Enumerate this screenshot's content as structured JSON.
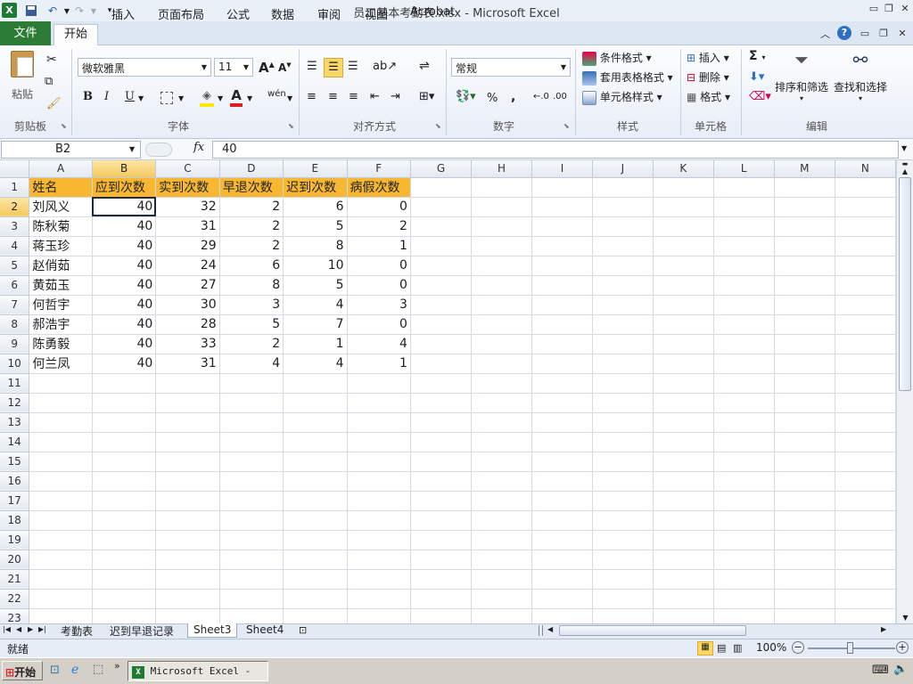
{
  "window": {
    "title": "员工基本考勤表.xlsx - Microsoft Excel",
    "app_icon": "excel-icon"
  },
  "ribbon_tabs": [
    "文件",
    "开始",
    "插入",
    "页面布局",
    "公式",
    "数据",
    "审阅",
    "视图",
    "Acrobat"
  ],
  "ribbon": {
    "clipboard": {
      "paste": "粘贴",
      "label": "剪贴板"
    },
    "font": {
      "name": "微软雅黑",
      "size": "11",
      "label": "字体",
      "bold": "B",
      "italic": "I",
      "underline": "U",
      "grow": "A",
      "shrink": "A",
      "color_a": "A",
      "wen": "wén"
    },
    "alignment": {
      "label": "对齐方式"
    },
    "number": {
      "format": "常规",
      "label": "数字",
      "percent": "%",
      "comma": ","
    },
    "styles": {
      "conditional": "条件格式",
      "table": "套用表格格式",
      "cell": "单元格样式",
      "label": "样式"
    },
    "cells": {
      "insert": "插入",
      "delete": "删除",
      "format": "格式",
      "label": "单元格"
    },
    "editing": {
      "sum": "Σ",
      "sort": "排序和筛选",
      "find": "查找和选择",
      "label": "编辑"
    }
  },
  "formula_bar": {
    "name_box": "B2",
    "fx": "fx",
    "value": "40"
  },
  "columns": [
    "A",
    "B",
    "C",
    "D",
    "E",
    "F",
    "G",
    "H",
    "I",
    "J",
    "K",
    "L",
    "M",
    "N"
  ],
  "rows": [
    "1",
    "2",
    "3",
    "4",
    "5",
    "6",
    "7",
    "8",
    "9",
    "10",
    "11",
    "12",
    "13",
    "14",
    "15",
    "16",
    "17",
    "18",
    "19",
    "20",
    "21",
    "22",
    "23"
  ],
  "table": {
    "headers": [
      "姓名",
      "应到次数",
      "实到次数",
      "早退次数",
      "迟到次数",
      "病假次数"
    ],
    "records": [
      [
        "刘风义",
        "40",
        "32",
        "2",
        "6",
        "0"
      ],
      [
        "陈秋菊",
        "40",
        "31",
        "2",
        "5",
        "2"
      ],
      [
        "蒋玉珍",
        "40",
        "29",
        "2",
        "8",
        "1"
      ],
      [
        "赵俏茹",
        "40",
        "24",
        "6",
        "10",
        "0"
      ],
      [
        "黄茹玉",
        "40",
        "27",
        "8",
        "5",
        "0"
      ],
      [
        "何哲宇",
        "40",
        "30",
        "3",
        "4",
        "3"
      ],
      [
        "郝浩宇",
        "40",
        "28",
        "5",
        "7",
        "0"
      ],
      [
        "陈勇毅",
        "40",
        "33",
        "2",
        "1",
        "4"
      ],
      [
        "何兰凤",
        "40",
        "31",
        "4",
        "4",
        "1"
      ]
    ]
  },
  "sheets": [
    "考勤表",
    "迟到早退记录",
    "Sheet3",
    "Sheet4"
  ],
  "active_sheet": "Sheet3",
  "status": {
    "ready": "就绪",
    "zoom": "100%"
  },
  "taskbar": {
    "start": "开始",
    "task": "Microsoft Excel - ..."
  },
  "colors": {
    "header_fill": "#f7b731",
    "cell_border": "#f0c34a",
    "file_tab": "#2c7c37"
  }
}
